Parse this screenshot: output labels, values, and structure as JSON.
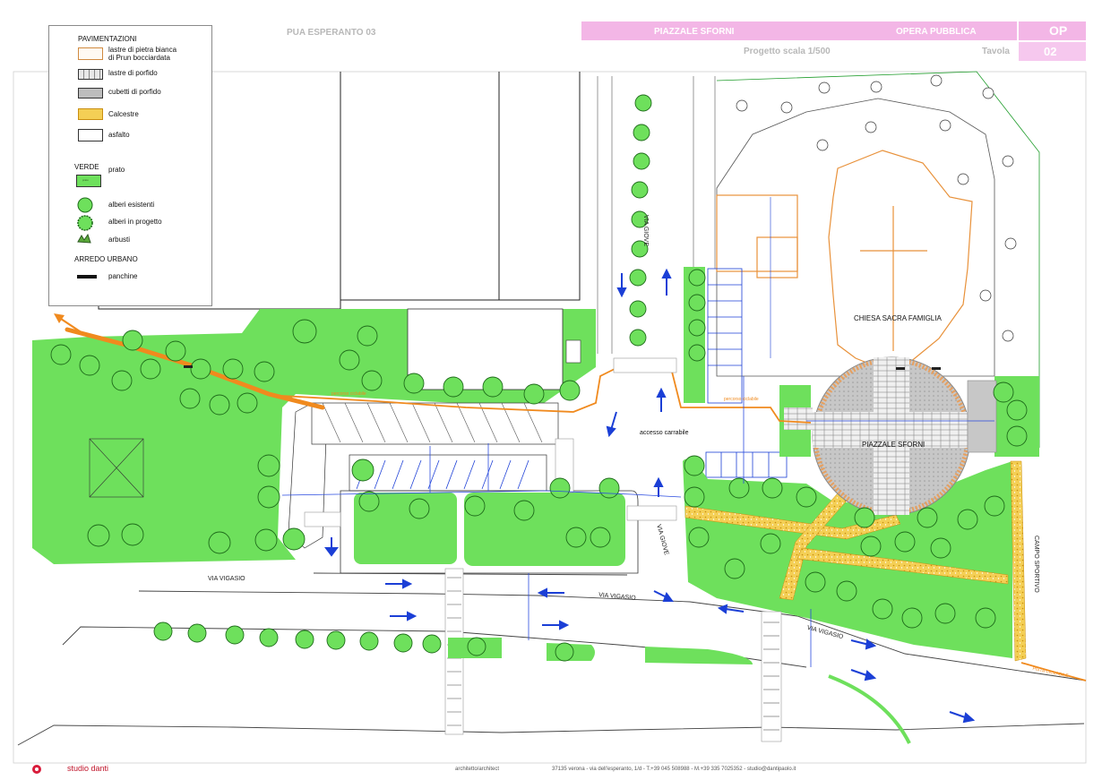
{
  "header": {
    "project": "PUA ESPERANTO 03",
    "piazzale": "PIAZZALE SFORNI",
    "opera": "OPERA PUBBLICA",
    "op": "OP",
    "scale": "Progetto scala 1/500",
    "tavola_label": "Tavola",
    "tavola_num": "02"
  },
  "legend": {
    "pavimentazioni_title": "PAVIMENTAZIONI",
    "pav1_line1": "lastre di pietra bianca",
    "pav1_line2": "di Prun bocciardata",
    "pav2": "lastre di porfido",
    "pav3": "cubetti di porfido",
    "pav4": "Calcestre",
    "pav5": "asfalto",
    "verde_title": "VERDE",
    "prato": "prato",
    "prato_swatch": "prato",
    "alberi_esistenti": "alberi esistenti",
    "alberi_progetto": "alberi in progetto",
    "arbusti": "arbusti",
    "arredo_title": "ARREDO URBANO",
    "panchine": "panchine"
  },
  "labels": {
    "via_giove_north": "VIA GIOVE",
    "via_giove_south": "VIA GIOVE",
    "via_vigasio_west": "VIA VIGASIO",
    "via_vigasio_mid": "VIA VIGASIO",
    "via_vigasio_east": "VIA VIGASIO",
    "chiesa": "CHIESA SACRA FAMIGLIA",
    "piazzale_sforni": "PIAZZALE SFORNI",
    "accesso_carrabile": "accesso carrabile",
    "campo_sportivo": "CAMPO SPORTIVO",
    "percorso_ciclabile_1": "percorso ciclabile",
    "percorso_ciclabile_2": "percorso ciclabile",
    "pista_ciclabile": "PISTA CICLABILE"
  },
  "footer": {
    "studio": "studio danti",
    "role": "architetto/architect",
    "address": "37135 verona - via dell'esperanto, 1/d - T.+39 045 508988 - M.+39 335 7025352 - studio@dantipaolo.it"
  },
  "colors": {
    "lawn": "#6ee05c",
    "lawn_light": "#c9f2bf",
    "cycle_path": "#f08a1e",
    "calcestre": "#f2c84e",
    "porfido": "#bdbdbd",
    "header_pink": "#f3b6e6",
    "arrow_blue": "#1b3fd6",
    "utility_blue": "#2a4be0",
    "church_outline": "#e8913a"
  }
}
